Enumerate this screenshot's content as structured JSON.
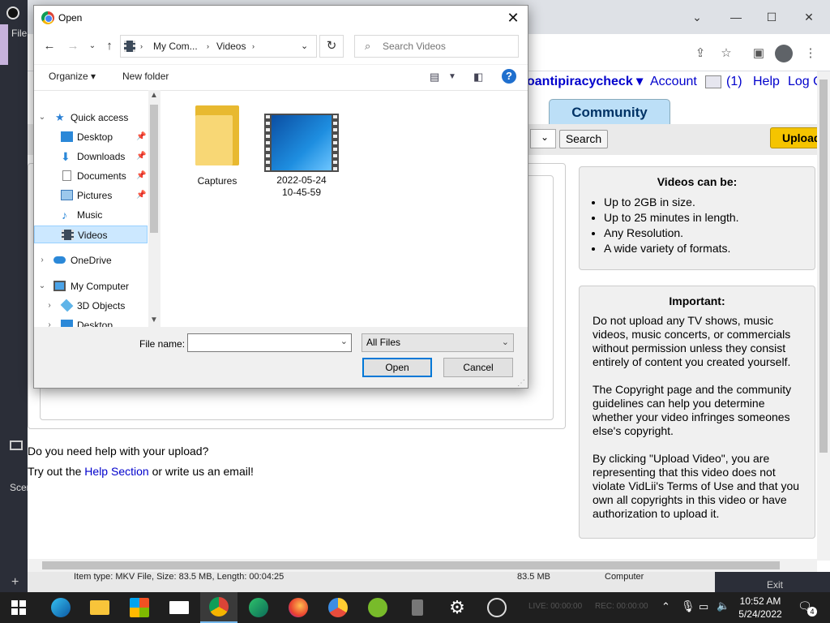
{
  "obs": {
    "menu_file": "File",
    "scenes_label": "Scen",
    "status_item": "Item type: MKV File, Size: 83.5 MB, Length: 00:04:25",
    "status_size": "83.5 MB",
    "status_location": "Computer",
    "live": "LIVE: 00:00:00",
    "rec": "REC: 00:00:00",
    "exit": "Exit"
  },
  "browser": {
    "nav_links": [
      "oantipiracycheck ▾",
      "Account",
      "(1)",
      "Help",
      "Log Out"
    ],
    "community_tab": "Community",
    "search_button": "Search",
    "upload_button": "Upload",
    "videos_can_be": {
      "title": "Videos can be:",
      "items": [
        "Up to 2GB in size.",
        "Up to 25 minutes in length.",
        "Any Resolution.",
        "A wide variety of formats."
      ]
    },
    "important": {
      "title": "Important:",
      "p1": "Do not upload any TV shows, music videos, music concerts, or commercials without permission unless they consist entirely of content you created yourself.",
      "p2": "The Copyright page and the community guidelines can help you determine whether your video infringes someones else's copyright.",
      "p3": "By clicking \"Upload Video\", you are representing that this video does not violate VidLii's Terms of Use and that you own all copyrights in this video or have authorization to upload it."
    },
    "help_q": "Do you need help with your upload?",
    "help_a_pre": "Try out the ",
    "help_link": "Help Section",
    "help_a_post": " or write us an email!"
  },
  "dialog": {
    "title": "Open",
    "breadcrumb": [
      "My Com...",
      "Videos"
    ],
    "search_placeholder": "Search Videos",
    "organize": "Organize ▾",
    "new_folder": "New folder",
    "nav": {
      "quick_access": "Quick access",
      "desktop": "Desktop",
      "downloads": "Downloads",
      "documents": "Documents",
      "pictures": "Pictures",
      "music": "Music",
      "videos": "Videos",
      "onedrive": "OneDrive",
      "my_computer": "My Computer",
      "objects3d": "3D Objects",
      "desktop2": "Desktop"
    },
    "files": [
      {
        "name": "Captures",
        "kind": "folder"
      },
      {
        "name": "2022-05-24\n10-45-59",
        "kind": "video"
      }
    ],
    "file_name_label": "File name:",
    "file_name_value": "",
    "file_type": "All Files",
    "open_button": "Open",
    "cancel_button": "Cancel"
  },
  "taskbar": {
    "time": "10:52 AM",
    "date": "5/24/2022",
    "notifications": "4"
  }
}
